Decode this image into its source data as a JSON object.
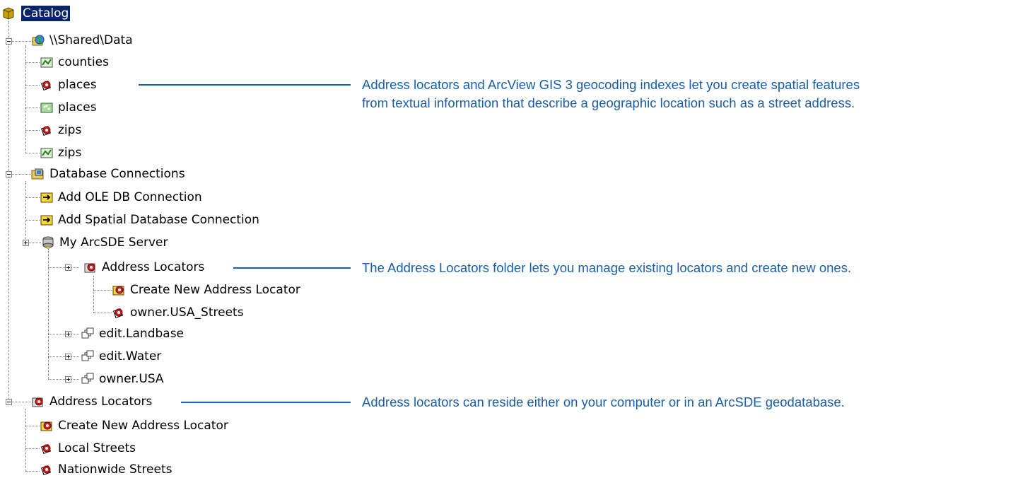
{
  "tree": {
    "root": {
      "label": "Catalog",
      "icon": "catalog-icon"
    },
    "shared_data": {
      "label": "\\\\Shared\\Data",
      "icon": "network-folder-icon",
      "children": [
        {
          "label": "counties",
          "icon": "geocoding-index-icon"
        },
        {
          "label": "places",
          "icon": "address-locator-icon"
        },
        {
          "label": "places",
          "icon": "geocoding-index-icon"
        },
        {
          "label": "zips",
          "icon": "address-locator-icon"
        },
        {
          "label": "zips",
          "icon": "geocoding-index-icon"
        }
      ]
    },
    "database_connections": {
      "label": "Database Connections",
      "icon": "database-connections-icon",
      "children": [
        {
          "label": "Add OLE DB Connection",
          "icon": "add-connection-icon"
        },
        {
          "label": "Add Spatial Database Connection",
          "icon": "add-connection-icon"
        }
      ],
      "server": {
        "label": "My ArcSDE Server",
        "icon": "arcsde-server-icon",
        "address_locators": {
          "label": "Address Locators",
          "icon": "address-locators-folder-icon",
          "children": [
            {
              "label": "Create New Address Locator",
              "icon": "new-locator-icon"
            },
            {
              "label": "owner.USA_Streets",
              "icon": "address-locator-icon"
            }
          ]
        },
        "datasets": [
          {
            "label": "edit.Landbase",
            "icon": "feature-dataset-icon"
          },
          {
            "label": "edit.Water",
            "icon": "feature-dataset-icon"
          },
          {
            "label": "owner.USA",
            "icon": "feature-dataset-icon"
          }
        ]
      }
    },
    "address_locators": {
      "label": "Address Locators",
      "icon": "address-locators-folder-icon",
      "children": [
        {
          "label": "Create New Address Locator",
          "icon": "new-locator-icon"
        },
        {
          "label": "Local Streets",
          "icon": "address-locator-icon"
        },
        {
          "label": "Nationwide Streets",
          "icon": "address-locator-icon"
        }
      ]
    }
  },
  "callouts": {
    "first_line1": "Address locators and ArcView GIS 3 geocoding indexes let you create spatial features",
    "first_line2": "from textual information that describe a geographic location such as a street address.",
    "second": "The Address Locators folder lets you manage existing locators and create new ones.",
    "third": "Address locators can reside either on your computer or in an ArcSDE geodatabase."
  },
  "colors": {
    "callout": "#1a5ea8",
    "selection": "#0a246a"
  }
}
